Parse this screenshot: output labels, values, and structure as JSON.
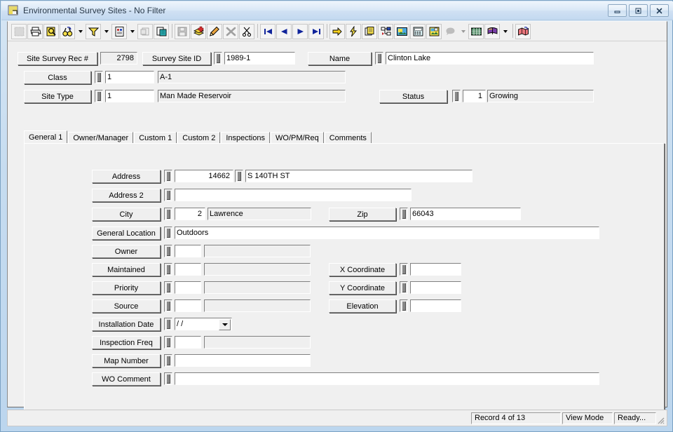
{
  "window": {
    "title": "Environmental Survey Sites - No Filter",
    "icon": "app-window-icon",
    "minimize_label": "–",
    "maximize_label": "❐",
    "close_label": "✕"
  },
  "toolbar": {
    "buttons": [
      {
        "name": "new-record-icon",
        "label": "New Record"
      },
      {
        "name": "print-icon",
        "label": "Print"
      },
      {
        "name": "print-preview-icon",
        "label": "Print Preview"
      },
      {
        "name": "find-icon",
        "label": "Find"
      },
      {
        "name": "find-dropdown-arrow-icon",
        "label": "Find Options"
      },
      {
        "name": "filter-icon",
        "label": "Filter"
      },
      {
        "name": "filter-dropdown-arrow-icon",
        "label": "Filter Options"
      },
      {
        "name": "report-icon",
        "label": "Report"
      },
      {
        "name": "report-dropdown-arrow-icon",
        "label": "Report Options"
      },
      {
        "name": "export-icon",
        "label": "Export"
      },
      {
        "name": "copy-record-icon",
        "label": "Copy Record"
      },
      {
        "name": "save-icon",
        "label": "Save"
      },
      {
        "name": "add-record-icon",
        "label": "Add Record"
      },
      {
        "name": "edit-record-icon",
        "label": "Edit Record"
      },
      {
        "name": "delete-record-icon",
        "label": "Delete Record"
      },
      {
        "name": "cut-icon",
        "label": "Cut"
      },
      {
        "name": "first-record-icon",
        "label": "First Record"
      },
      {
        "name": "previous-record-icon",
        "label": "Previous Record"
      },
      {
        "name": "next-record-icon",
        "label": "Next Record"
      },
      {
        "name": "last-record-icon",
        "label": "Last Record"
      },
      {
        "name": "goto-icon",
        "label": "Go To"
      },
      {
        "name": "quick-action-icon",
        "label": "Quick Action"
      },
      {
        "name": "documents-icon",
        "label": "Documents"
      },
      {
        "name": "tree-view-icon",
        "label": "Tree View"
      },
      {
        "name": "image-icon",
        "label": "Image"
      },
      {
        "name": "calculator-icon",
        "label": "Calculator"
      },
      {
        "name": "picture-icon",
        "label": "Picture"
      },
      {
        "name": "help-balloon-icon",
        "label": "Help"
      },
      {
        "name": "help-dropdown-arrow-icon",
        "label": "Help Options"
      },
      {
        "name": "spreadsheet-icon",
        "label": "Spreadsheet"
      },
      {
        "name": "book-icon",
        "label": "Lookup Book"
      },
      {
        "name": "book-dropdown-arrow-icon",
        "label": "Lookup Options"
      },
      {
        "name": "map-icon",
        "label": "Map"
      }
    ]
  },
  "header": {
    "site_survey_rec_label": "Site Survey Rec #",
    "site_survey_rec_value": "2798",
    "survey_site_id_label": "Survey Site ID",
    "survey_site_id_value": "1989-1",
    "name_label": "Name",
    "name_value": "Clinton Lake",
    "class_label": "Class",
    "class_code": "1",
    "class_desc": "A-1",
    "site_type_label": "Site Type",
    "site_type_code": "1",
    "site_type_desc": "Man Made Reservoir",
    "status_label": "Status",
    "status_code": "1",
    "status_desc": "Growing"
  },
  "tabs": [
    {
      "label": "General 1",
      "active": true
    },
    {
      "label": "Owner/Manager",
      "active": false
    },
    {
      "label": "Custom 1",
      "active": false
    },
    {
      "label": "Custom 2",
      "active": false
    },
    {
      "label": "Inspections",
      "active": false
    },
    {
      "label": "WO/PM/Req",
      "active": false
    },
    {
      "label": "Comments",
      "active": false
    }
  ],
  "general1": {
    "address_label": "Address",
    "address_number": "14662",
    "address_street": "S 140TH ST",
    "address2_label": "Address 2",
    "address2_value": "",
    "city_label": "City",
    "city_code": "2",
    "city_name": "Lawrence",
    "zip_label": "Zip",
    "zip_value": "66043",
    "general_location_label": "General Location",
    "general_location_value": "Outdoors",
    "owner_label": "Owner",
    "owner_code": "",
    "owner_desc": "",
    "maintained_label": "Maintained",
    "maintained_code": "",
    "maintained_desc": "",
    "priority_label": "Priority",
    "priority_code": "",
    "priority_desc": "",
    "source_label": "Source",
    "source_code": "",
    "source_desc": "",
    "x_coordinate_label": "X Coordinate",
    "x_coordinate_value": "",
    "y_coordinate_label": "Y Coordinate",
    "y_coordinate_value": "",
    "elevation_label": "Elevation",
    "elevation_value": "",
    "installation_date_label": "Installation Date",
    "installation_date_value": "/  /",
    "inspection_freq_label": "Inspection Freq",
    "inspection_freq_code": "",
    "inspection_freq_desc": "",
    "map_number_label": "Map Number",
    "map_number_value": "",
    "wo_comment_label": "WO Comment",
    "wo_comment_value": ""
  },
  "statusbar": {
    "record_position": "Record 4 of 13",
    "mode": "View Mode",
    "state": "Ready..."
  }
}
